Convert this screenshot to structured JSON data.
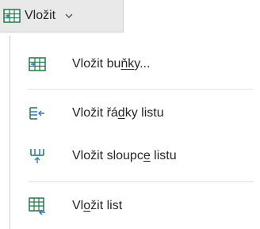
{
  "ribbon_button": {
    "label": "Vložit",
    "icon": "insert-cells-icon",
    "chevron_icon": "chevron-down-icon"
  },
  "menu": {
    "items": [
      {
        "label_pre": "Vložit bu",
        "label_key": "ň",
        "label_mid": "k",
        "label_post": "y...",
        "icon": "insert-cells-icon"
      },
      {
        "label_pre": "Vložit řá",
        "label_key": "d",
        "label_post": "ky listu",
        "icon": "insert-rows-icon"
      },
      {
        "label_pre": "Vložit sloupc",
        "label_key": "e",
        "label_post": " listu",
        "icon": "insert-columns-icon"
      },
      {
        "label_pre": "Vl",
        "label_key": "o",
        "label_post": "žit list",
        "icon": "insert-sheet-icon"
      }
    ]
  },
  "colors": {
    "accent_green": "#1e7b45",
    "accent_blue": "#2b79c5",
    "button_bg": "#e9e9e9",
    "text": "#262626"
  }
}
